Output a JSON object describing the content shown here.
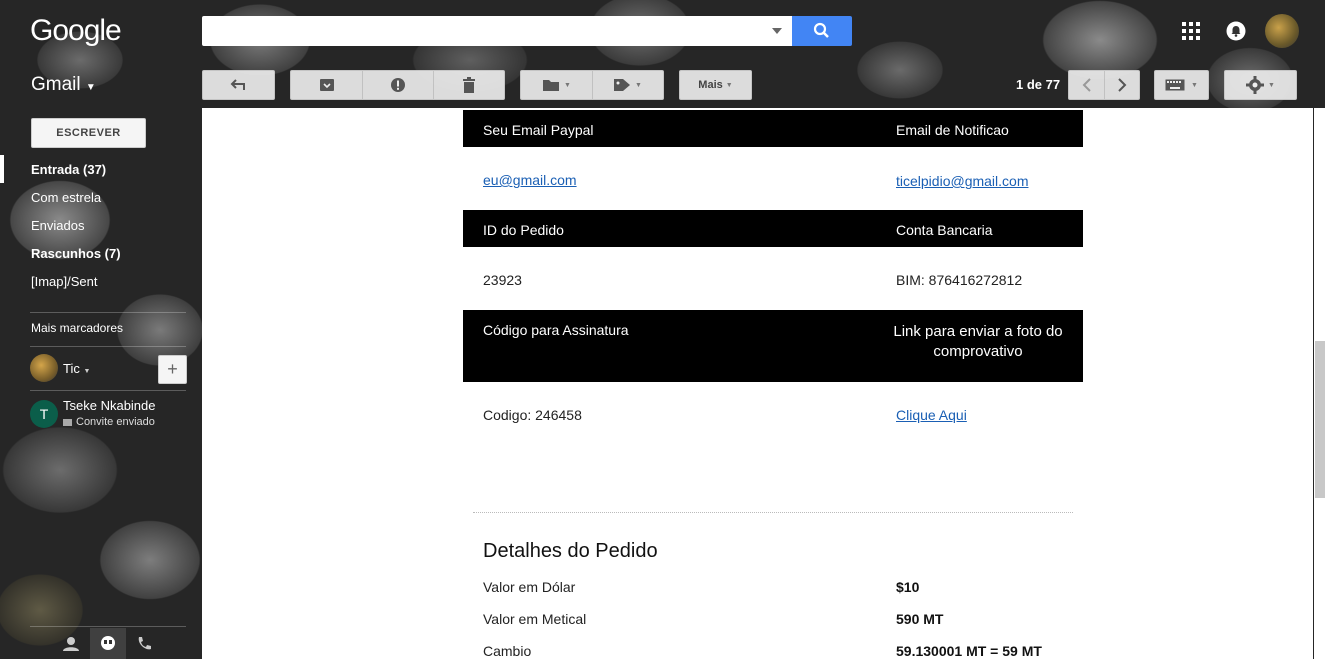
{
  "header": {
    "logo": "Google"
  },
  "app": {
    "name": "Gmail"
  },
  "toolbar": {
    "more_label": "Mais",
    "pagination": "1 de 77"
  },
  "sidebar": {
    "compose_label": "ESCREVER",
    "items": [
      {
        "label": "Entrada (37)"
      },
      {
        "label": "Com estrela"
      },
      {
        "label": "Enviados"
      },
      {
        "label": "Rascunhos (7)"
      },
      {
        "label": "[Imap]/Sent"
      }
    ],
    "more_labels": "Mais marcadores",
    "user": {
      "name": "Tic"
    },
    "contact": {
      "initial": "T",
      "name": "Tseke Nkabinde",
      "status": "Convite enviado"
    }
  },
  "email": {
    "row1": {
      "h_left": "Seu Email Paypal",
      "h_right": "Email de Notificao",
      "v_left": "eu@gmail.com",
      "v_right": "ticelpidio@gmail.com"
    },
    "row2": {
      "h_left": "ID do Pedido",
      "h_right": "Conta Bancaria",
      "v_left": "23923",
      "v_right": "BIM: 876416272812"
    },
    "row3": {
      "h_left": "Código para Assinatura",
      "h_right": "Link para enviar a foto do comprovativo",
      "v_left": "Codigo: 246458",
      "v_right": "Clique Aqui"
    },
    "details": {
      "title": "Detalhes do Pedido",
      "rows": [
        {
          "label": "Valor em Dólar",
          "value": "$10"
        },
        {
          "label": "Valor em Metical",
          "value": "590 MT"
        },
        {
          "label": "Cambio",
          "value": "59.130001 MT = 59 MT"
        }
      ]
    }
  }
}
